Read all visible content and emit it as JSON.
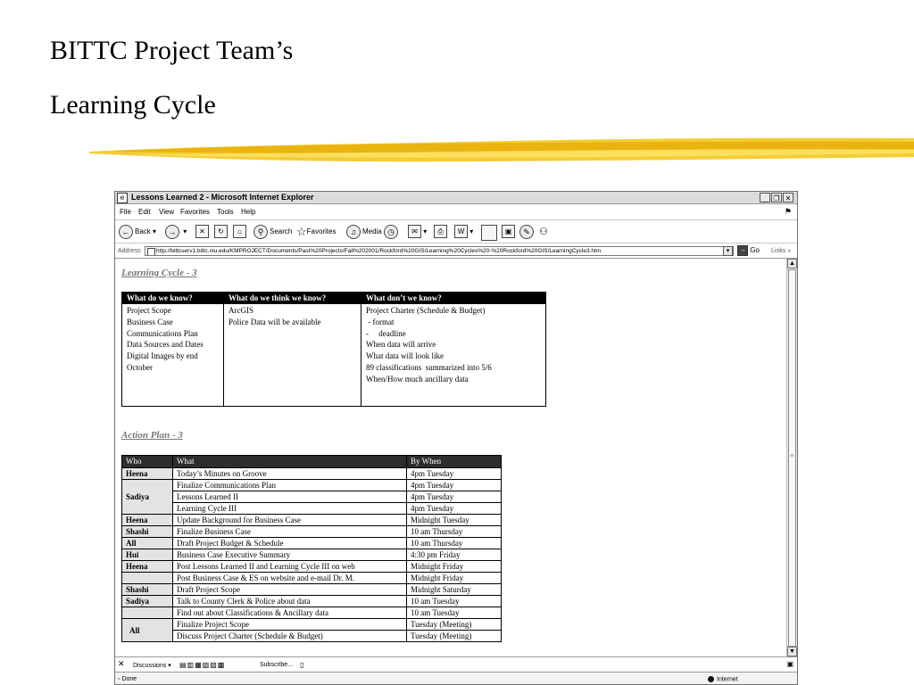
{
  "slide": {
    "title_line1": "BITTC Project Team’s",
    "title_line2": "Learning Cycle"
  },
  "browser": {
    "window_title": "Lessons Learned 2 - Microsoft Internet Explorer",
    "menu": [
      "File",
      "Edit",
      "View",
      "Favorites",
      "Tools",
      "Help"
    ],
    "toolbar": {
      "back": "Back",
      "search": "Search",
      "favorites": "Favorites",
      "media": "Media"
    },
    "address_label": "Address",
    "url": "http://bittcserv1.bittc.niu.edu/KMPROJECT/Documents/Past%20Projects/Fall%202001/Rockford%20GIS/Learning%20Cycles%20-%20Rockford%20GIS/LearningCycle3.htm",
    "go": "Go",
    "links": "Links",
    "links_bar": {
      "discussions": "Discussions",
      "subscribe": "Subscribe..."
    },
    "status": {
      "text": "Done",
      "zone": "Internet"
    }
  },
  "learning_cycle": {
    "heading": "Learning Cycle - 3",
    "columns": [
      {
        "header": "What do we know?",
        "items": [
          "Project Scope",
          "Business Case",
          "Communications Plan",
          "Data Sources and Dates",
          "Digital Images by end",
          "October"
        ]
      },
      {
        "header": "What do we think we know?",
        "items": [
          "ArcGIS",
          "Police Data will be available"
        ]
      },
      {
        "header": "What don’t we know?",
        "items": [
          "Project Charter (Schedule & Budget)",
          " - format",
          "-     deadline",
          "When data will arrive",
          "What data will look like",
          "89 classifications  summarized into 5/6",
          "When/How much ancillary data"
        ]
      }
    ]
  },
  "action_plan": {
    "heading": "Action Plan - 3",
    "headers": [
      "Who",
      "What",
      "By When"
    ],
    "rows": [
      {
        "who": "Heena",
        "what": "Today’s Minutes on Groove",
        "when": "4pm Tuesday"
      },
      {
        "who": "Sadiya",
        "what": "Finalize Communications Plan",
        "when": "4pm Tuesday"
      },
      {
        "who": "",
        "what": "Lessons Learned II",
        "when": "4pm Tuesday"
      },
      {
        "who": "",
        "what": "Learning Cycle III",
        "when": "4pm Tuesday"
      },
      {
        "who": "Heena",
        "what": "Update Background for Business Case",
        "when": "Midnight Tuesday"
      },
      {
        "who": "Shashi",
        "what": "Finalize Business Case",
        "when": "10 am Thursday"
      },
      {
        "who": "All",
        "what": "Draft Project Budget & Schedule",
        "when": "10 am Thursday"
      },
      {
        "who": "Hui",
        "what": "Business Case Executive Summary",
        "when": "4:30 pm Friday"
      },
      {
        "who": "Heena",
        "what": "Post Lessons Learned II and Learning Cycle III on web",
        "when": "Midnight Friday"
      },
      {
        "who": "",
        "what": "Post Business Case & ES on website and e-mail Dr. M.",
        "when": "Midnight Friday"
      },
      {
        "who": "Shashi",
        "what": "Draft Project Scope",
        "when": "Midnight Saturday"
      },
      {
        "who": "Sadiya",
        "what": "Talk to County Clerk & Police about data",
        "when": "10 am Tuesday"
      },
      {
        "who": "",
        "what": "Find out about Classifications & Ancillary data",
        "when": "10 am Tuesday"
      },
      {
        "who": "All",
        "what": "Finalize Project Scope",
        "when": "Tuesday (Meeting)"
      },
      {
        "who": "",
        "what": "Discuss Project Charter (Schedule & Budget)",
        "when": "Tuesday (Meeting)"
      }
    ]
  },
  "colors": {
    "brush_yellow": "#f2c40f",
    "header_black": "#000000",
    "who_gray": "#e3e3e3"
  }
}
